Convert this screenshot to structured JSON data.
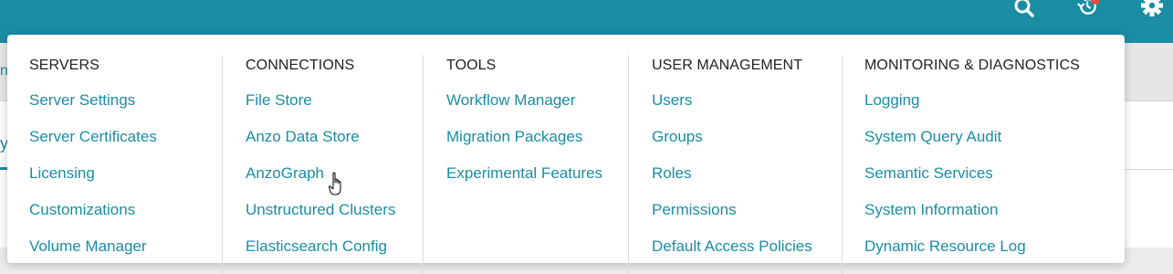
{
  "topbar": {
    "icons": [
      "search-icon",
      "history-icon",
      "gear-icon"
    ],
    "accent": "#1a8da3",
    "badge_color": "#e84a3c"
  },
  "background": {
    "edge_text": "ni",
    "edge_tab": "y"
  },
  "menu": {
    "columns": [
      {
        "heading": "SERVERS",
        "items": [
          "Server Settings",
          "Server Certificates",
          "Licensing",
          "Customizations",
          "Volume Manager"
        ]
      },
      {
        "heading": "CONNECTIONS",
        "items": [
          "File Store",
          "Anzo Data Store",
          "AnzoGraph",
          "Unstructured Clusters",
          "Elasticsearch Config"
        ]
      },
      {
        "heading": "TOOLS",
        "items": [
          "Workflow Manager",
          "Migration Packages",
          "Experimental Features"
        ]
      },
      {
        "heading": "USER MANAGEMENT",
        "items": [
          "Users",
          "Groups",
          "Roles",
          "Permissions",
          "Default Access Policies"
        ]
      },
      {
        "heading": "MONITORING & DIAGNOSTICS",
        "items": [
          "Logging",
          "System Query Audit",
          "Semantic Services",
          "System Information",
          "Dynamic Resource Log"
        ]
      }
    ]
  }
}
